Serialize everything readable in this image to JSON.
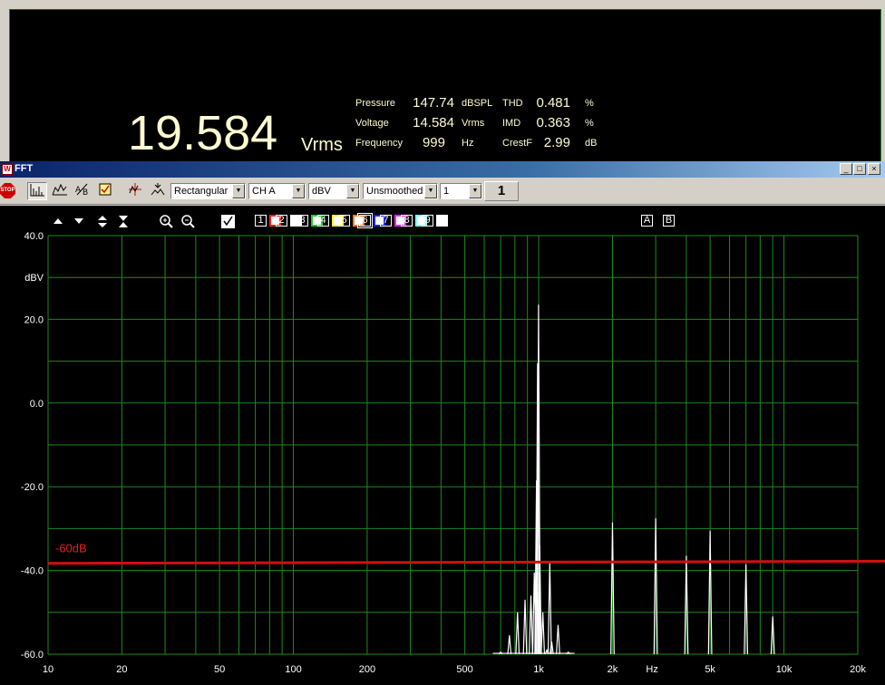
{
  "meter": {
    "main_value": "19.584",
    "main_unit": "Vrms",
    "readings": [
      {
        "label": "Pressure",
        "value": "147.74",
        "unit": "dBSPL"
      },
      {
        "label": "Voltage",
        "value": "14.584",
        "unit": "Vrms"
      },
      {
        "label": "Frequency",
        "value": "999",
        "unit": "Hz"
      },
      {
        "label": "THD",
        "value": "0.481",
        "unit": "%"
      },
      {
        "label": "IMD",
        "value": "0.363",
        "unit": "%"
      },
      {
        "label": "CrestF",
        "value": "2.99",
        "unit": "dB"
      }
    ]
  },
  "window": {
    "title": "FFT",
    "minimize": "_",
    "maximize": "□",
    "close": "×"
  },
  "toolbar": {
    "stop_label": "STOP",
    "window_function": "Rectangular",
    "channel": "CH A",
    "unit": "dBV",
    "smoothing": "Unsmoothed",
    "averages": "1",
    "average_count": "1"
  },
  "trace_controls": {
    "traces": [
      {
        "num": "1",
        "color": "#ff2020"
      },
      {
        "num": "2",
        "color": "#ffffff"
      },
      {
        "num": "3",
        "color": "#20d020"
      },
      {
        "num": "4",
        "color": "#ffff20"
      },
      {
        "num": "5",
        "color": "#ff8020"
      },
      {
        "num": "6",
        "color": "#2020ff"
      },
      {
        "num": "7",
        "color": "#ff20ff"
      },
      {
        "num": "8",
        "color": "#80ffff"
      },
      {
        "num": "9",
        "color": "#ffffff"
      }
    ],
    "ab": [
      "A",
      "B"
    ],
    "active_trace": "6"
  },
  "chart_data": {
    "type": "line",
    "x_scale": "log",
    "xlim": [
      10,
      20000
    ],
    "ylim": [
      -60,
      40
    ],
    "ylabel": "dBV",
    "xlabel": "Hz",
    "y_ticks": [
      "40.0",
      "20.0",
      "0.0",
      "-20.0",
      "-40.0",
      "-60.0"
    ],
    "y_tick_values": [
      40,
      20,
      0,
      -20,
      -40,
      -60
    ],
    "x_ticks": [
      "10",
      "20",
      "50",
      "100",
      "200",
      "500",
      "1k",
      "2k",
      "5k",
      "10k",
      "20k"
    ],
    "x_tick_values": [
      10,
      20,
      50,
      100,
      200,
      500,
      1000,
      2000,
      5000,
      10000,
      20000
    ],
    "grid": true,
    "reference_line": {
      "label": "-60dB",
      "y_start": -38.3,
      "y_end": -37.8,
      "color": "#d01010"
    },
    "series": [
      {
        "color": "#ffffff",
        "peaks": [
          {
            "x": 700,
            "y": -59.5
          },
          {
            "x": 760,
            "y": -55.5
          },
          {
            "x": 820,
            "y": -50
          },
          {
            "x": 880,
            "y": -47
          },
          {
            "x": 930,
            "y": -46
          },
          {
            "x": 960,
            "y": -40.5
          },
          {
            "x": 980,
            "y": -18.5
          },
          {
            "x": 990,
            "y": 9.5
          },
          {
            "x": 999,
            "y": 23.5
          },
          {
            "x": 1010,
            "y": -34
          },
          {
            "x": 1040,
            "y": -50
          },
          {
            "x": 1080,
            "y": -59
          },
          {
            "x": 1110,
            "y": -38
          },
          {
            "x": 1130,
            "y": -57
          },
          {
            "x": 1200,
            "y": -53
          },
          {
            "x": 1320,
            "y": -59.5
          },
          {
            "x": 2000,
            "y": -28.5
          },
          {
            "x": 3000,
            "y": -27.5
          },
          {
            "x": 4000,
            "y": -36.5
          },
          {
            "x": 5000,
            "y": -30.5
          },
          {
            "x": 7000,
            "y": -38.5
          },
          {
            "x": 9000,
            "y": -51
          }
        ]
      }
    ]
  }
}
